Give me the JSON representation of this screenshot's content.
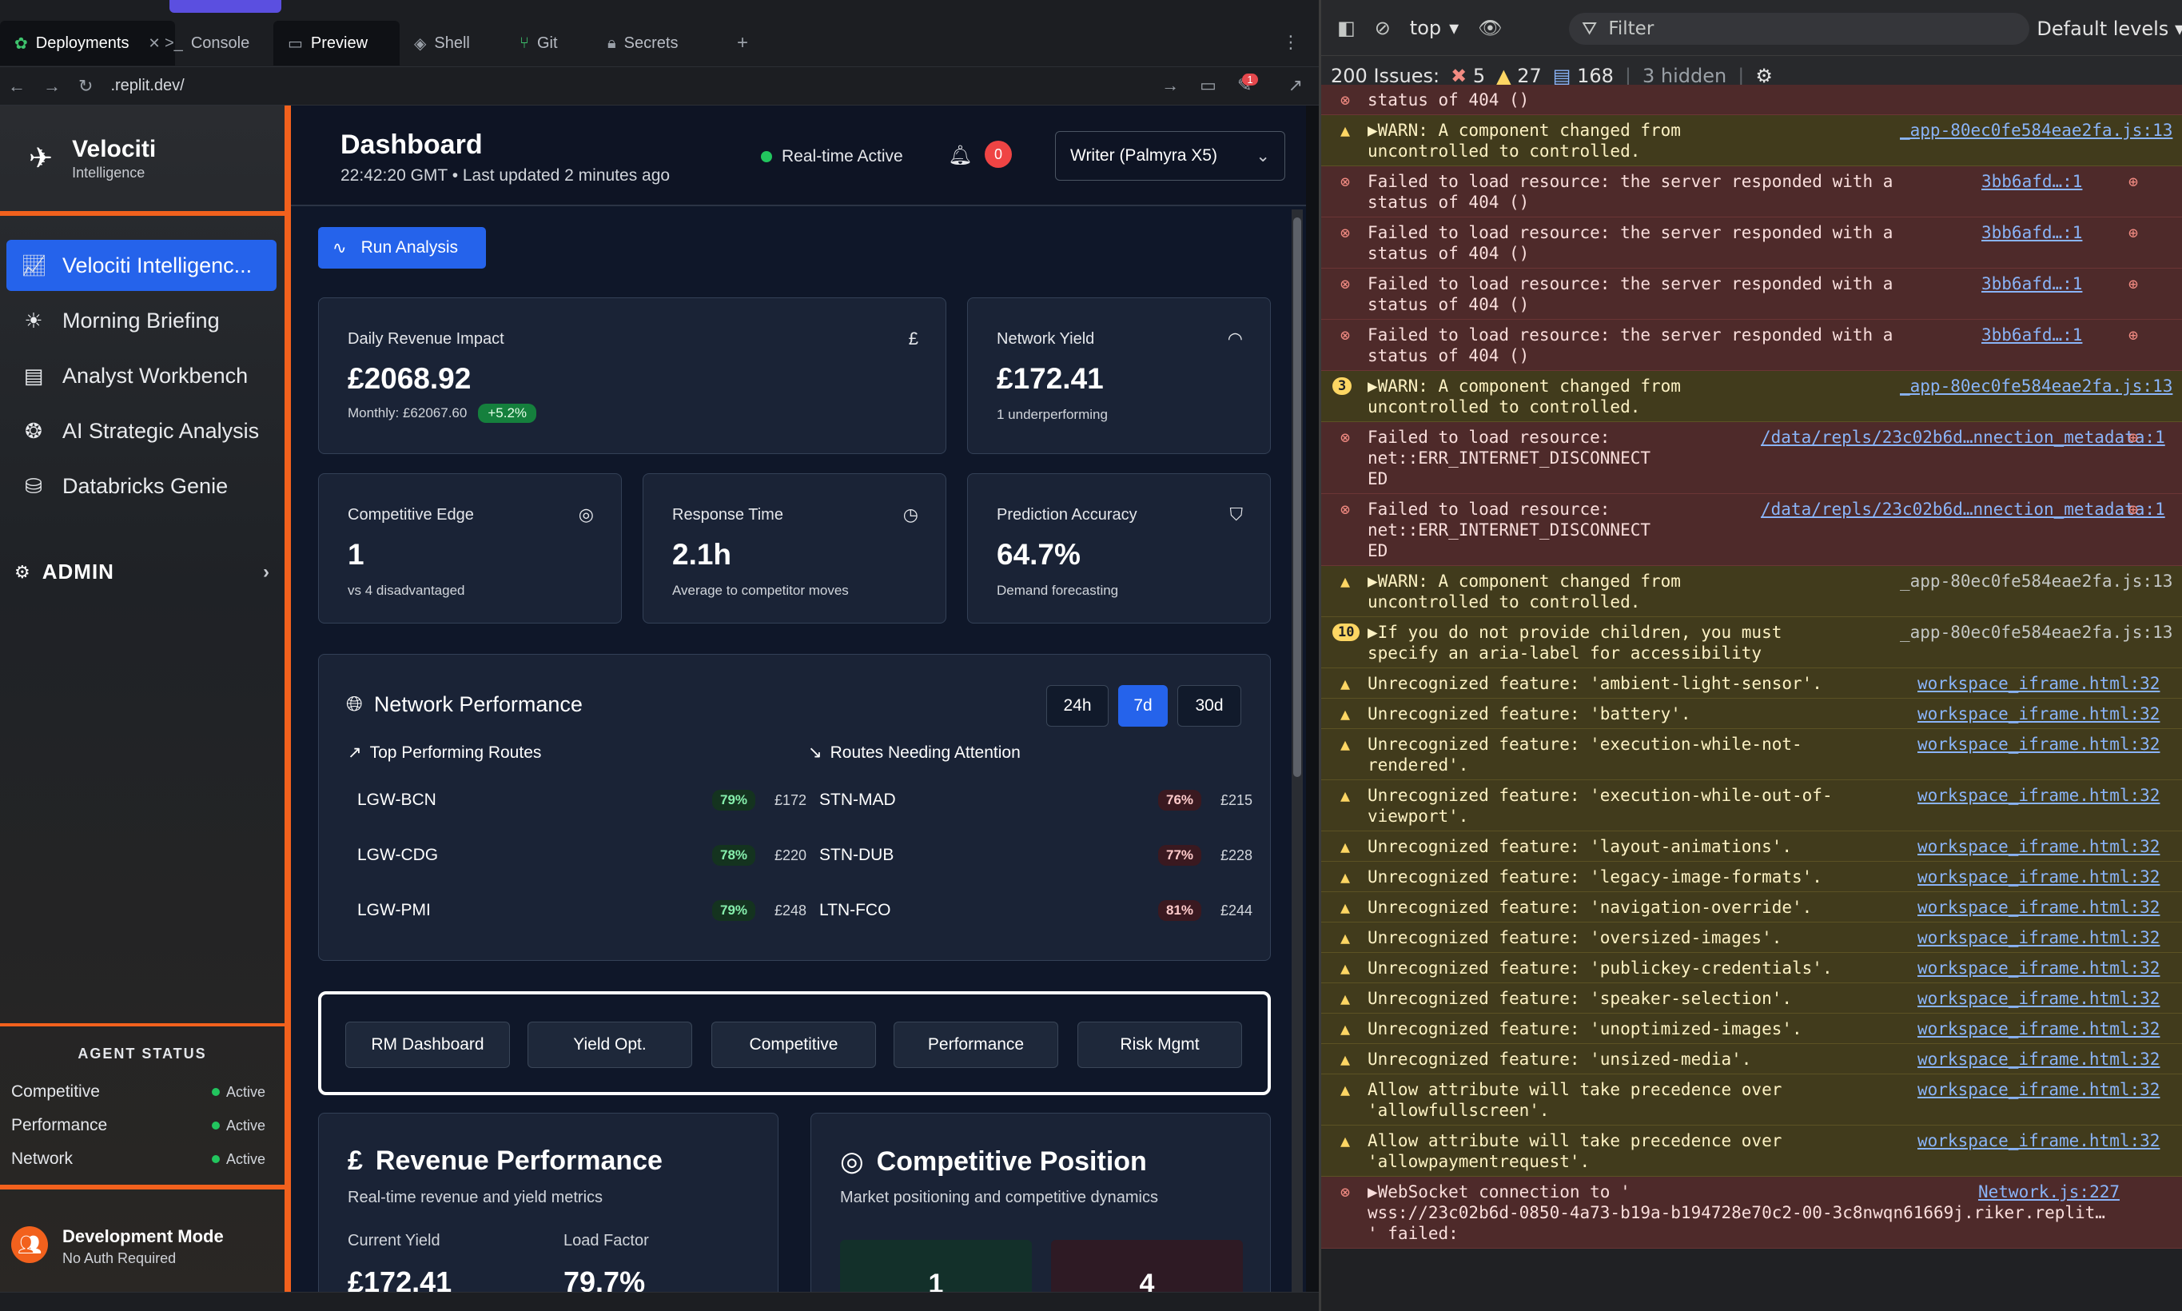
{
  "replit": {
    "tabs": [
      {
        "label": "Deployments",
        "icon": "leaf-icon",
        "closable": true
      },
      {
        "label": "Console",
        "icon": "terminal-icon"
      },
      {
        "label": "Preview",
        "icon": "monitor-icon"
      },
      {
        "label": "Shell",
        "icon": "shell-icon"
      },
      {
        "label": "Git",
        "icon": "git-icon"
      },
      {
        "label": "Secrets",
        "icon": "lock-icon"
      }
    ],
    "url": ".replit.dev/",
    "notif_count": "1"
  },
  "app": {
    "brand": {
      "title": "Velociti",
      "subtitle": "Intelligence"
    },
    "nav": [
      {
        "label": "Velociti Intelligenc...",
        "icon": "chart-line-icon",
        "active": true
      },
      {
        "label": "Morning Briefing",
        "icon": "sunrise-icon"
      },
      {
        "label": "Analyst Workbench",
        "icon": "clipboard-icon"
      },
      {
        "label": "AI Strategic Analysis",
        "icon": "brain-icon"
      },
      {
        "label": "Databricks Genie",
        "icon": "database-icon"
      }
    ],
    "admin_label": "ADMIN",
    "agent_status": {
      "heading": "AGENT STATUS",
      "agents": [
        {
          "name": "Competitive",
          "status": "Active"
        },
        {
          "name": "Performance",
          "status": "Active"
        },
        {
          "name": "Network",
          "status": "Active"
        }
      ]
    },
    "dev": {
      "title": "Development Mode",
      "subtitle": "No Auth Required"
    }
  },
  "dashboard": {
    "title": "Dashboard",
    "subtitle": "22:42:20 GMT • Last updated 2 minutes ago",
    "realtime": "Real-time Active",
    "notifications": "0",
    "model": "Writer (Palmyra X5)",
    "run_label": "Run Analysis",
    "cards": {
      "revenue": {
        "label": "Daily Revenue Impact",
        "value": "£2068.92",
        "sub": "Monthly: £62067.60",
        "delta": "+5.2%",
        "icon": "pound-icon"
      },
      "yield": {
        "label": "Network Yield",
        "value": "£172.41",
        "sub": "1 underperforming",
        "icon": "gauge-icon"
      },
      "edge": {
        "label": "Competitive Edge",
        "value": "1",
        "sub": "vs 4 disadvantaged",
        "icon": "target-icon"
      },
      "response": {
        "label": "Response Time",
        "value": "2.1h",
        "sub": "Average to competitor moves",
        "icon": "clock-icon"
      },
      "accuracy": {
        "label": "Prediction Accuracy",
        "value": "64.7%",
        "sub": "Demand forecasting",
        "icon": "shield-icon"
      }
    },
    "network": {
      "title": "Network Performance",
      "ranges": [
        "24h",
        "7d",
        "30d"
      ],
      "selected_range": "7d",
      "top_heading": "Top Performing Routes",
      "attention_heading": "Routes Needing Attention",
      "top_routes": [
        {
          "route": "LGW-BCN",
          "pct": "79%",
          "price": "£172"
        },
        {
          "route": "LGW-CDG",
          "pct": "78%",
          "price": "£220"
        },
        {
          "route": "LGW-PMI",
          "pct": "79%",
          "price": "£248"
        }
      ],
      "attention_routes": [
        {
          "route": "STN-MAD",
          "pct": "76%",
          "price": "£215"
        },
        {
          "route": "STN-DUB",
          "pct": "77%",
          "price": "£228"
        },
        {
          "route": "LTN-FCO",
          "pct": "81%",
          "price": "£244"
        }
      ]
    },
    "view_tabs": [
      "RM Dashboard",
      "Yield Opt.",
      "Competitive",
      "Performance",
      "Risk Mgmt"
    ],
    "revenue_perf": {
      "title": "Revenue Performance",
      "subtitle": "Real-time revenue and yield metrics",
      "m1_label": "Current Yield",
      "m1_value": "£172.41",
      "m2_label": "Load Factor",
      "m2_value": "79.7%"
    },
    "comp_pos": {
      "title": "Competitive Position",
      "subtitle": "Market positioning and competitive dynamics",
      "v1": "1",
      "v2": "4"
    }
  },
  "devtools": {
    "context": "top",
    "filter_placeholder": "Filter",
    "levels": "Default levels",
    "issues_label": "200 Issues:",
    "errors": "5",
    "warnings": "27",
    "infos": "168",
    "hidden": "3 hidden",
    "messages": [
      {
        "type": "err",
        "lines": [
          "status of 404 ()"
        ],
        "src": ""
      },
      {
        "type": "warn",
        "lines": [
          "▶WARN: A component changed from",
          "uncontrolled to controlled."
        ],
        "src": "_app-80ec0fe584eae2fa.js:13"
      },
      {
        "type": "err",
        "lines": [
          "Failed to load resource: the server responded with a",
          "status of 404 ()"
        ],
        "src": "3bb6afd…:1"
      },
      {
        "type": "err",
        "lines": [
          "Failed to load resource: the server responded with a",
          "status of 404 ()"
        ],
        "src": "3bb6afd…:1"
      },
      {
        "type": "err",
        "lines": [
          "Failed to load resource: the server responded with a",
          "status of 404 ()"
        ],
        "src": "3bb6afd…:1"
      },
      {
        "type": "err",
        "lines": [
          "Failed to load resource: the server responded with a",
          "status of 404 ()"
        ],
        "src": "3bb6afd…:1"
      },
      {
        "type": "warn",
        "count": "3",
        "lines": [
          "▶WARN: A component changed from",
          "uncontrolled to controlled."
        ],
        "src": "_app-80ec0fe584eae2fa.js:13"
      },
      {
        "type": "err",
        "lines": [
          "Failed to load resource:",
          "net::ERR_INTERNET_DISCONNECT",
          "ED"
        ],
        "src": "/data/repls/23c02b6d…nnection_metadata:1"
      },
      {
        "type": "err",
        "lines": [
          "Failed to load resource:",
          "net::ERR_INTERNET_DISCONNECT",
          "ED"
        ],
        "src": "/data/repls/23c02b6d…nnection_metadata:1"
      },
      {
        "type": "warn",
        "lines": [
          "▶WARN: A component changed from",
          "uncontrolled to controlled."
        ],
        "src": "_app-80ec0fe584eae2fa.js:13"
      },
      {
        "type": "warn",
        "count": "10",
        "lines": [
          "▶If you do not provide children, you must",
          "specify an aria-label for accessibility"
        ],
        "src": "_app-80ec0fe584eae2fa.js:13"
      },
      {
        "type": "warn",
        "lines": [
          "Unrecognized feature: 'ambient-light-sensor'."
        ],
        "src": "workspace_iframe.html:32"
      },
      {
        "type": "warn",
        "lines": [
          "Unrecognized feature: 'battery'."
        ],
        "src": "workspace_iframe.html:32"
      },
      {
        "type": "warn",
        "lines": [
          "Unrecognized feature: 'execution-while-not-",
          "rendered'."
        ],
        "src": "workspace_iframe.html:32"
      },
      {
        "type": "warn",
        "lines": [
          "Unrecognized feature: 'execution-while-out-of-",
          "viewport'."
        ],
        "src": "workspace_iframe.html:32"
      },
      {
        "type": "warn",
        "lines": [
          "Unrecognized feature: 'layout-animations'."
        ],
        "src": "workspace_iframe.html:32"
      },
      {
        "type": "warn",
        "lines": [
          "Unrecognized feature: 'legacy-image-formats'."
        ],
        "src": "workspace_iframe.html:32"
      },
      {
        "type": "warn",
        "lines": [
          "Unrecognized feature: 'navigation-override'."
        ],
        "src": "workspace_iframe.html:32"
      },
      {
        "type": "warn",
        "lines": [
          "Unrecognized feature: 'oversized-images'."
        ],
        "src": "workspace_iframe.html:32"
      },
      {
        "type": "warn",
        "lines": [
          "Unrecognized feature: 'publickey-credentials'."
        ],
        "src": "workspace_iframe.html:32"
      },
      {
        "type": "warn",
        "lines": [
          "Unrecognized feature: 'speaker-selection'."
        ],
        "src": "workspace_iframe.html:32"
      },
      {
        "type": "warn",
        "lines": [
          "Unrecognized feature: 'unoptimized-images'."
        ],
        "src": "workspace_iframe.html:32"
      },
      {
        "type": "warn",
        "lines": [
          "Unrecognized feature: 'unsized-media'."
        ],
        "src": "workspace_iframe.html:32"
      },
      {
        "type": "warn",
        "lines": [
          "Allow attribute will take precedence over",
          "'allowfullscreen'."
        ],
        "src": "workspace_iframe.html:32"
      },
      {
        "type": "warn",
        "lines": [
          "Allow attribute will take precedence over",
          "'allowpaymentrequest'."
        ],
        "src": "workspace_iframe.html:32"
      },
      {
        "type": "err",
        "lines": [
          "▶WebSocket connection to '",
          "wss://23c02b6d-0850-4a73-b19a-b194728e70c2-00-3c8nwqn61669j.riker.replit…",
          "' failed:"
        ],
        "src": "Network.js:227"
      }
    ]
  }
}
